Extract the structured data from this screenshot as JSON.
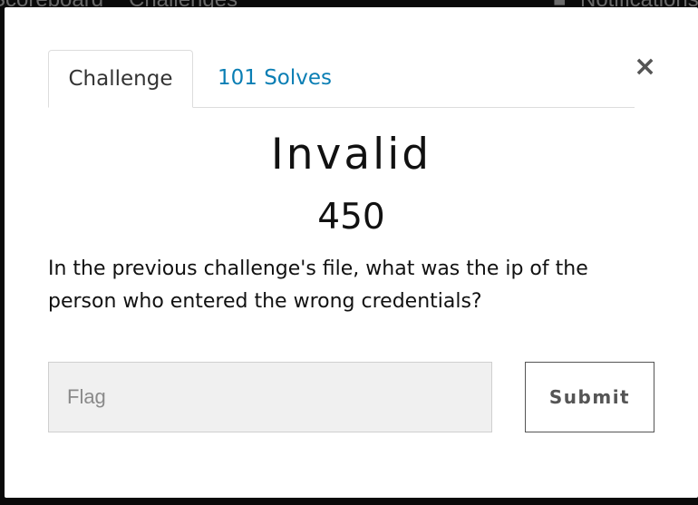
{
  "backdrop_nav": {
    "items": [
      "Scoreboard",
      "Challenges"
    ],
    "notifications_label": "Notifications"
  },
  "modal": {
    "tabs": [
      {
        "label": "Challenge",
        "active": true
      },
      {
        "label": "101 Solves",
        "active": false
      }
    ],
    "close_symbol": "×",
    "title": "Invalid",
    "points": "450",
    "description": "In the previous challenge's file, what was the ip of the person who entered the wrong credentials?",
    "flag_input": {
      "placeholder": "Flag",
      "value": ""
    },
    "submit_label": "Submit"
  },
  "colors": {
    "backdrop": "#0a0a0a",
    "tab_link": "#0a7eb4",
    "input_bg": "#f0f0f0"
  }
}
